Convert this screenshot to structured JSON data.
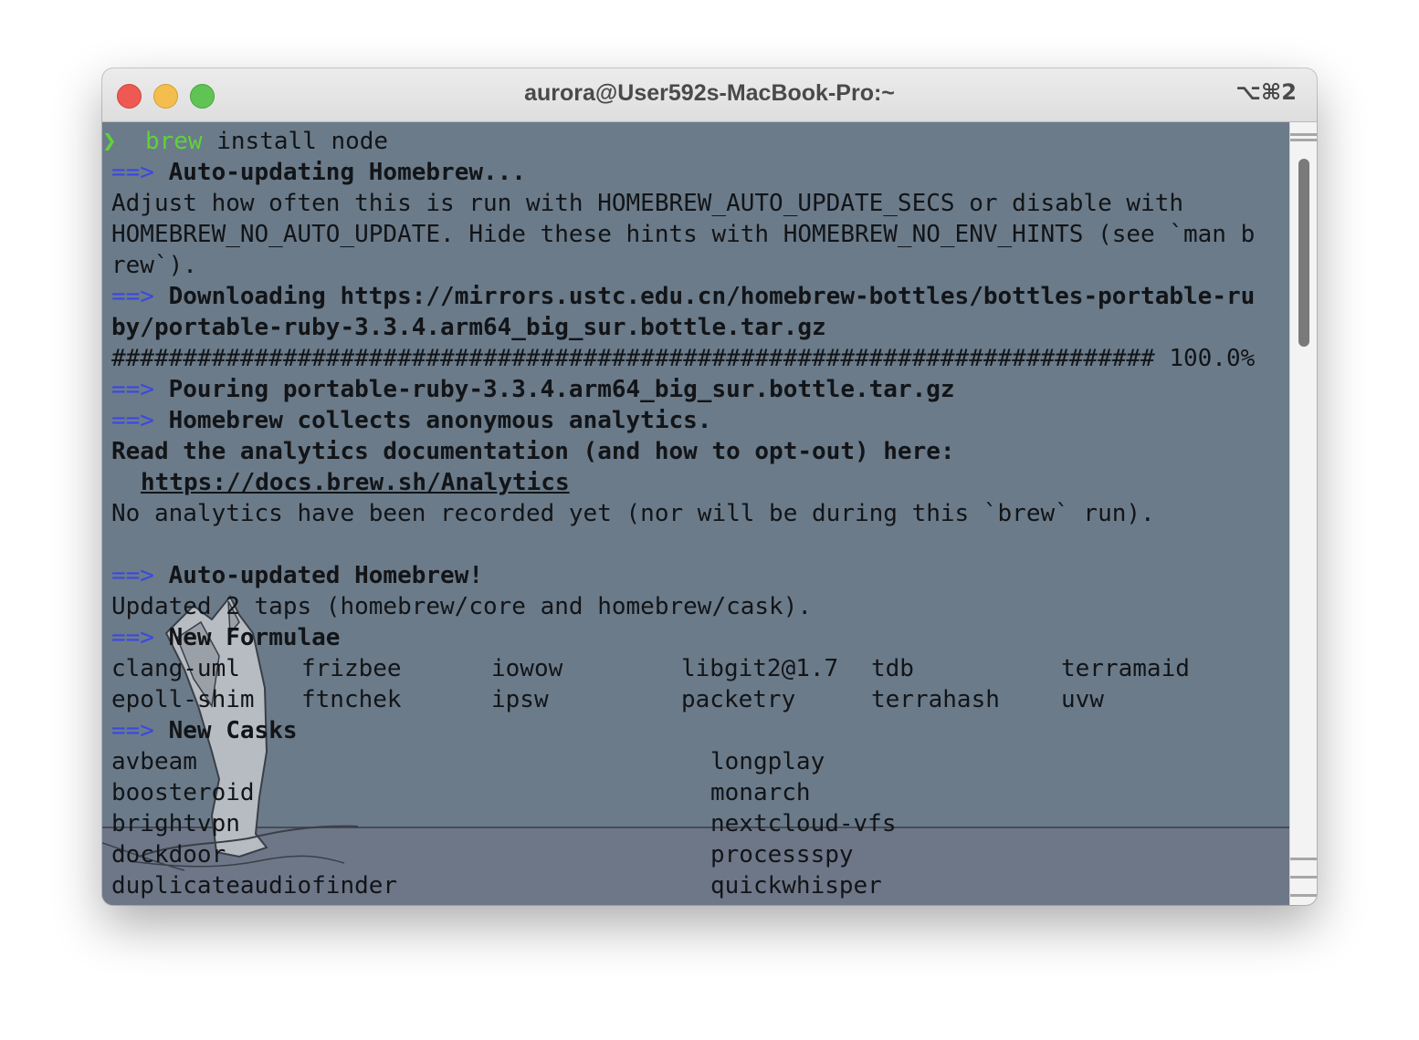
{
  "window": {
    "title": "aurora@User592s-MacBook-Pro:~",
    "shortcut": "⌥⌘2"
  },
  "terminal": {
    "prompt_command": "brew",
    "prompt_args": " install node",
    "arrow": "==>",
    "lines": {
      "auto_updating": "Auto-updating Homebrew...",
      "hint1": "Adjust how often this is run with HOMEBREW_AUTO_UPDATE_SECS or disable with",
      "hint2": "HOMEBREW_NO_AUTO_UPDATE. Hide these hints with HOMEBREW_NO_ENV_HINTS (see `man b",
      "hint3": "rew`).",
      "downloading": "Downloading https://mirrors.ustc.edu.cn/homebrew-bottles/bottles-portable-ru",
      "downloading_cont": "by/portable-ruby-3.3.4.arm64_big_sur.bottle.tar.gz",
      "progress": "######################################################################### 100.0%",
      "pouring": "Pouring portable-ruby-3.3.4.arm64_big_sur.bottle.tar.gz",
      "analytics_head": "Homebrew collects anonymous analytics.",
      "analytics_read": "Read the analytics documentation (and how to opt-out) here:",
      "analytics_url": "https://docs.brew.sh/Analytics",
      "analytics_none": "No analytics have been recorded yet (nor will be during this `brew` run).",
      "auto_updated": "Auto-updated Homebrew!",
      "updated_taps": "Updated 2 taps (homebrew/core and homebrew/cask).",
      "new_formulae": "New Formulae",
      "new_casks": "New Casks"
    },
    "formulae": [
      [
        "clang-uml",
        "frizbee",
        "iowow",
        "libgit2@1.7",
        "tdb",
        "terramaid"
      ],
      [
        "epoll-shim",
        "ftnchek",
        "ipsw",
        "packetry",
        "terrahash",
        "uvw"
      ]
    ],
    "casks_left": [
      "avbeam",
      "boosteroid",
      "brightvpn",
      "dockdoor",
      "duplicateaudiofinder"
    ],
    "casks_right": [
      "longplay",
      "monarch",
      "nextcloud-vfs",
      "processspy",
      "quickwhisper"
    ]
  },
  "colors": {
    "terminal_bg": "#6b7b8a",
    "arrow": "#3a48e0",
    "prompt_green": "#5fd33a",
    "text": "#121417"
  },
  "icons": [
    "close-button",
    "minimize-button",
    "maximize-button",
    "prompt-chevron-icon",
    "cat-background-illustration"
  ]
}
